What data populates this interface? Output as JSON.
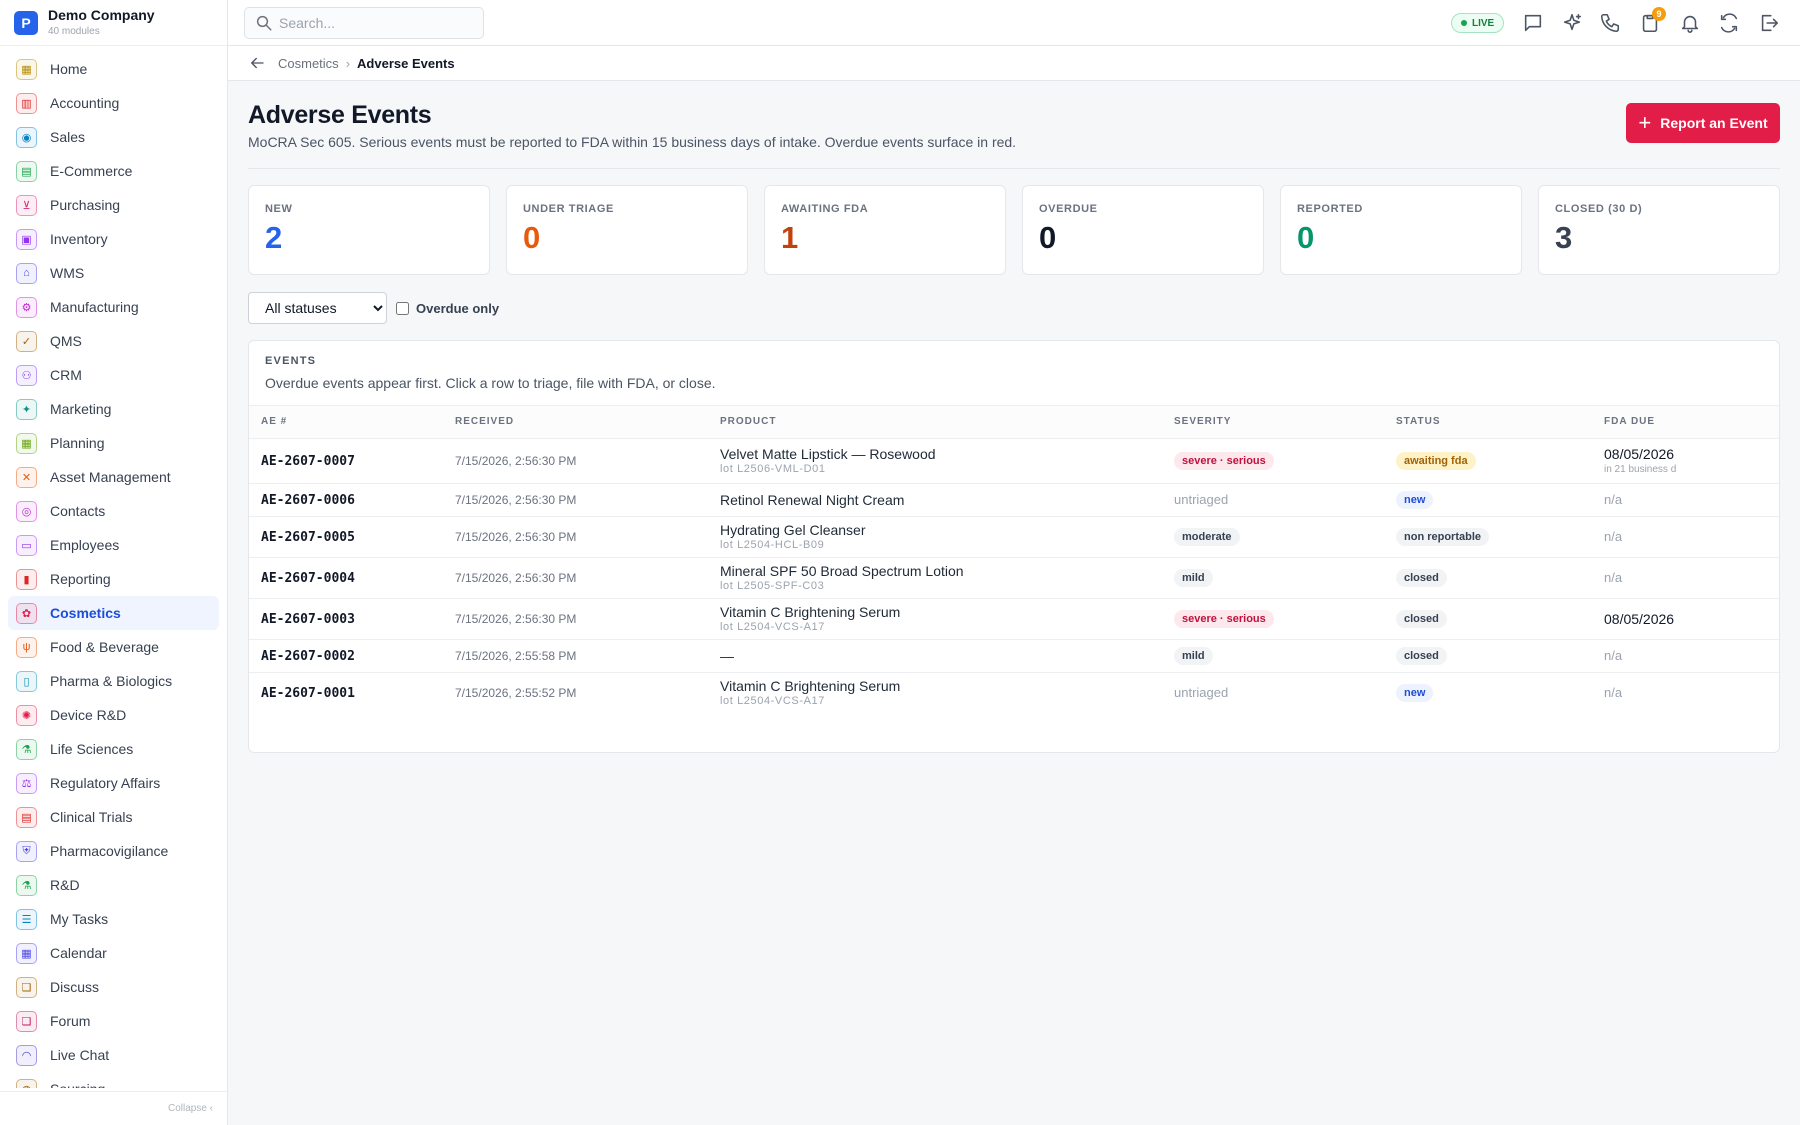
{
  "brand": {
    "logo_letter": "P",
    "name": "Demo Company",
    "subtitle": "40 modules"
  },
  "sidebar": {
    "items": [
      {
        "label": "Home",
        "icon": "grid-icon",
        "glyph": "▦",
        "color": "#b58b00"
      },
      {
        "label": "Accounting",
        "icon": "bank-icon",
        "glyph": "▥",
        "color": "#dc2626"
      },
      {
        "label": "Sales",
        "icon": "user-icon",
        "glyph": "◉",
        "color": "#0284c7"
      },
      {
        "label": "E-Commerce",
        "icon": "store-icon",
        "glyph": "▤",
        "color": "#16a34a"
      },
      {
        "label": "Purchasing",
        "icon": "cart-icon",
        "glyph": "⊻",
        "color": "#db2777"
      },
      {
        "label": "Inventory",
        "icon": "box-icon",
        "glyph": "▣",
        "color": "#9333ea"
      },
      {
        "label": "WMS",
        "icon": "warehouse-icon",
        "glyph": "⌂",
        "color": "#4f46e5"
      },
      {
        "label": "Manufacturing",
        "icon": "factory-icon",
        "glyph": "⚙",
        "color": "#c026d3"
      },
      {
        "label": "QMS",
        "icon": "check-badge-icon",
        "glyph": "✓",
        "color": "#a16207"
      },
      {
        "label": "CRM",
        "icon": "users-icon",
        "glyph": "⚇",
        "color": "#7c3aed"
      },
      {
        "label": "Marketing",
        "icon": "megaphone-icon",
        "glyph": "✦",
        "color": "#0d9488"
      },
      {
        "label": "Planning",
        "icon": "calendar-grid-icon",
        "glyph": "▦",
        "color": "#65a30d"
      },
      {
        "label": "Asset Management",
        "icon": "wrench-icon",
        "glyph": "✕",
        "color": "#ea580c"
      },
      {
        "label": "Contacts",
        "icon": "contact-icon",
        "glyph": "◎",
        "color": "#c026d3"
      },
      {
        "label": "Employees",
        "icon": "briefcase-icon",
        "glyph": "▭",
        "color": "#9333ea"
      },
      {
        "label": "Reporting",
        "icon": "bar-chart-icon",
        "glyph": "▮",
        "color": "#dc2626"
      },
      {
        "label": "Cosmetics",
        "icon": "flower-icon",
        "glyph": "✿",
        "color": "#e11d48",
        "active": true
      },
      {
        "label": "Food & Beverage",
        "icon": "utensils-icon",
        "glyph": "ψ",
        "color": "#ea580c"
      },
      {
        "label": "Pharma & Biologics",
        "icon": "pill-bottle-icon",
        "glyph": "▯",
        "color": "#0891b2"
      },
      {
        "label": "Device R&D",
        "icon": "cog-icon",
        "glyph": "✺",
        "color": "#e11d48"
      },
      {
        "label": "Life Sciences",
        "icon": "microscope-icon",
        "glyph": "⚗",
        "color": "#16a34a"
      },
      {
        "label": "Regulatory Affairs",
        "icon": "gavel-icon",
        "glyph": "⚖",
        "color": "#9333ea"
      },
      {
        "label": "Clinical Trials",
        "icon": "clipboard-icon",
        "glyph": "▤",
        "color": "#dc2626"
      },
      {
        "label": "Pharmacovigilance",
        "icon": "shield-icon",
        "glyph": "⛨",
        "color": "#4f46e5"
      },
      {
        "label": "R&D",
        "icon": "flask-icon",
        "glyph": "⚗",
        "color": "#16a34a"
      },
      {
        "label": "My Tasks",
        "icon": "checklist-icon",
        "glyph": "☰",
        "color": "#0284c7"
      },
      {
        "label": "Calendar",
        "icon": "calendar-icon",
        "glyph": "▦",
        "color": "#4f46e5"
      },
      {
        "label": "Discuss",
        "icon": "chat-bubbles-icon",
        "glyph": "❏",
        "color": "#a16207"
      },
      {
        "label": "Forum",
        "icon": "forum-icon",
        "glyph": "❏",
        "color": "#be185d"
      },
      {
        "label": "Live Chat",
        "icon": "headset-icon",
        "glyph": "◠",
        "color": "#4338ca"
      },
      {
        "label": "Sourcing",
        "icon": "sourcing-icon",
        "glyph": "◍",
        "color": "#a16207"
      }
    ],
    "collapse_label": "Collapse ‹"
  },
  "topbar": {
    "search_placeholder": "Search...",
    "live_label": "LIVE",
    "notification_count": "9",
    "icons": [
      "chat-icon",
      "sparkle-icon",
      "phone-icon",
      "clipboard-badge-icon",
      "bell-icon",
      "refresh-icon",
      "logout-icon"
    ]
  },
  "breadcrumb": {
    "parent": "Cosmetics",
    "separator": "›",
    "current": "Adverse Events"
  },
  "header": {
    "title": "Adverse Events",
    "subtitle": "MoCRA Sec 605. Serious events must be reported to FDA within 15 business days of intake. Overdue events surface in red.",
    "primary_action": "Report an Event"
  },
  "stats": [
    {
      "label": "NEW",
      "value": "2",
      "color": "#2563eb"
    },
    {
      "label": "UNDER TRIAGE",
      "value": "0",
      "color": "#ea580c"
    },
    {
      "label": "AWAITING FDA",
      "value": "1",
      "color": "#c2410c"
    },
    {
      "label": "OVERDUE",
      "value": "0",
      "color": "#111827"
    },
    {
      "label": "REPORTED",
      "value": "0",
      "color": "#059669"
    },
    {
      "label": "CLOSED (30 D)",
      "value": "3",
      "color": "#374151"
    }
  ],
  "filters": {
    "status_selected": "All statuses",
    "overdue_label": "Overdue only"
  },
  "events": {
    "title": "EVENTS",
    "subtitle": "Overdue events appear first. Click a row to triage, file with FDA, or close.",
    "columns": [
      "AE #",
      "RECEIVED",
      "PRODUCT",
      "SEVERITY",
      "STATUS",
      "FDA DUE"
    ],
    "rows": [
      {
        "ae": "AE-2607-0007",
        "received": "7/15/2026, 2:56:30 PM",
        "product": "Velvet Matte Lipstick — Rosewood",
        "lot": "lot L2506-VML-D01",
        "severity": "severe · serious",
        "severity_kind": "severe",
        "status": "awaiting fda",
        "status_kind": "awaiting",
        "due": "08/05/2026",
        "due_note": "in 21 business d"
      },
      {
        "ae": "AE-2607-0006",
        "received": "7/15/2026, 2:56:30 PM",
        "product": "Retinol Renewal Night Cream",
        "lot": "",
        "severity": "untriaged",
        "severity_kind": "untriaged",
        "status": "new",
        "status_kind": "new",
        "due": "n/a",
        "due_note": ""
      },
      {
        "ae": "AE-2607-0005",
        "received": "7/15/2026, 2:56:30 PM",
        "product": "Hydrating Gel Cleanser",
        "lot": "lot L2504-HCL-B09",
        "severity": "moderate",
        "severity_kind": "gray",
        "status": "non reportable",
        "status_kind": "gray",
        "due": "n/a",
        "due_note": ""
      },
      {
        "ae": "AE-2607-0004",
        "received": "7/15/2026, 2:56:30 PM",
        "product": "Mineral SPF 50 Broad Spectrum Lotion",
        "lot": "lot L2505-SPF-C03",
        "severity": "mild",
        "severity_kind": "gray",
        "status": "closed",
        "status_kind": "gray",
        "due": "n/a",
        "due_note": ""
      },
      {
        "ae": "AE-2607-0003",
        "received": "7/15/2026, 2:56:30 PM",
        "product": "Vitamin C Brightening Serum",
        "lot": "lot L2504-VCS-A17",
        "severity": "severe · serious",
        "severity_kind": "severe",
        "status": "closed",
        "status_kind": "gray",
        "due": "08/05/2026",
        "due_note": ""
      },
      {
        "ae": "AE-2607-0002",
        "received": "7/15/2026, 2:55:58 PM",
        "product": "—",
        "lot": "",
        "severity": "mild",
        "severity_kind": "gray",
        "status": "closed",
        "status_kind": "gray",
        "due": "n/a",
        "due_note": ""
      },
      {
        "ae": "AE-2607-0001",
        "received": "7/15/2026, 2:55:52 PM",
        "product": "Vitamin C Brightening Serum",
        "lot": "lot L2504-VCS-A17",
        "severity": "untriaged",
        "severity_kind": "untriaged",
        "status": "new",
        "status_kind": "new",
        "due": "n/a",
        "due_note": ""
      }
    ]
  }
}
